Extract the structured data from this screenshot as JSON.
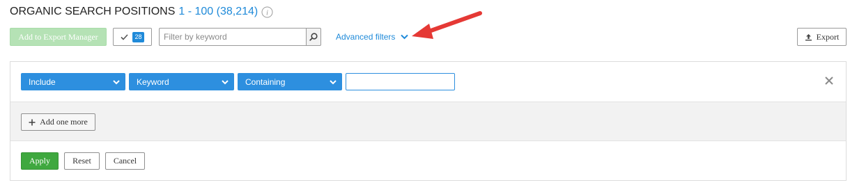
{
  "header": {
    "title": "ORGANIC SEARCH POSITIONS",
    "range": "1 - 100 (38,214)",
    "info_icon": "info-icon"
  },
  "toolbar": {
    "export_manager_label": "Add to Export Manager",
    "selected_count": "28",
    "search_placeholder": "Filter by keyword",
    "advanced_filters_label": "Advanced filters",
    "export_label": "Export"
  },
  "filter": {
    "include_value": "Include",
    "field_value": "Keyword",
    "condition_value": "Containing",
    "input_value": "",
    "add_more_label": "Add one more"
  },
  "actions": {
    "apply_label": "Apply",
    "reset_label": "Reset",
    "cancel_label": "Cancel"
  },
  "colors": {
    "accent_blue": "#1f8ad9",
    "dropdown_blue": "#2d8fdf",
    "apply_green": "#3fa83f",
    "disabled_green": "#b5e2b5",
    "annotation_red": "#e53935"
  }
}
